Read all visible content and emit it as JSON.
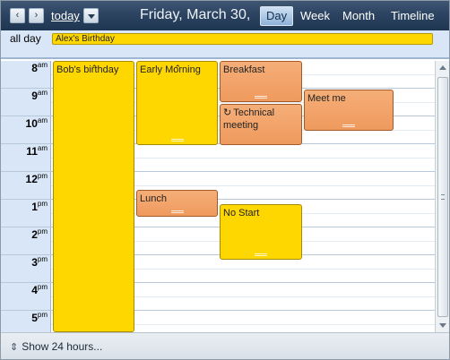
{
  "toolbar": {
    "prev_icon": "‹",
    "next_icon": "›",
    "today_label": "today",
    "date_title": "Friday, March 30,",
    "views": [
      "Day",
      "Week",
      "Month",
      "Timeline"
    ],
    "active_view": "Day"
  },
  "allday": {
    "label": "all day",
    "events": [
      {
        "title": "Alex's Birthday",
        "color": "#ffd700"
      }
    ]
  },
  "hours": [
    {
      "num": "8",
      "ampm": "am"
    },
    {
      "num": "9",
      "ampm": "am"
    },
    {
      "num": "10",
      "ampm": "am"
    },
    {
      "num": "11",
      "ampm": "am"
    },
    {
      "num": "12",
      "ampm": "pm"
    },
    {
      "num": "1",
      "ampm": "pm"
    },
    {
      "num": "2",
      "ampm": "pm"
    },
    {
      "num": "3",
      "ampm": "pm"
    },
    {
      "num": "4",
      "ampm": "pm"
    },
    {
      "num": "5",
      "ampm": "pm"
    }
  ],
  "events": [
    {
      "title": "Bob's birthday",
      "color": "yellow",
      "reminder": true
    },
    {
      "title": "Early Morning",
      "color": "yellow",
      "reminder": true
    },
    {
      "title": "Breakfast",
      "color": "orange"
    },
    {
      "title": "Technical meeting",
      "color": "orange",
      "recurring": true
    },
    {
      "title": "Meet me",
      "color": "orange"
    },
    {
      "title": "Lunch",
      "color": "orange"
    },
    {
      "title": "No Start",
      "color": "yellow"
    }
  ],
  "footer": {
    "icon": "⇕",
    "label": "Show 24 hours..."
  },
  "colors": {
    "toolbar_bg": "#2c4461",
    "timecol_bg": "#d8e6f7",
    "event_yellow": "#ffd700",
    "event_orange": "#ef9a5e"
  }
}
